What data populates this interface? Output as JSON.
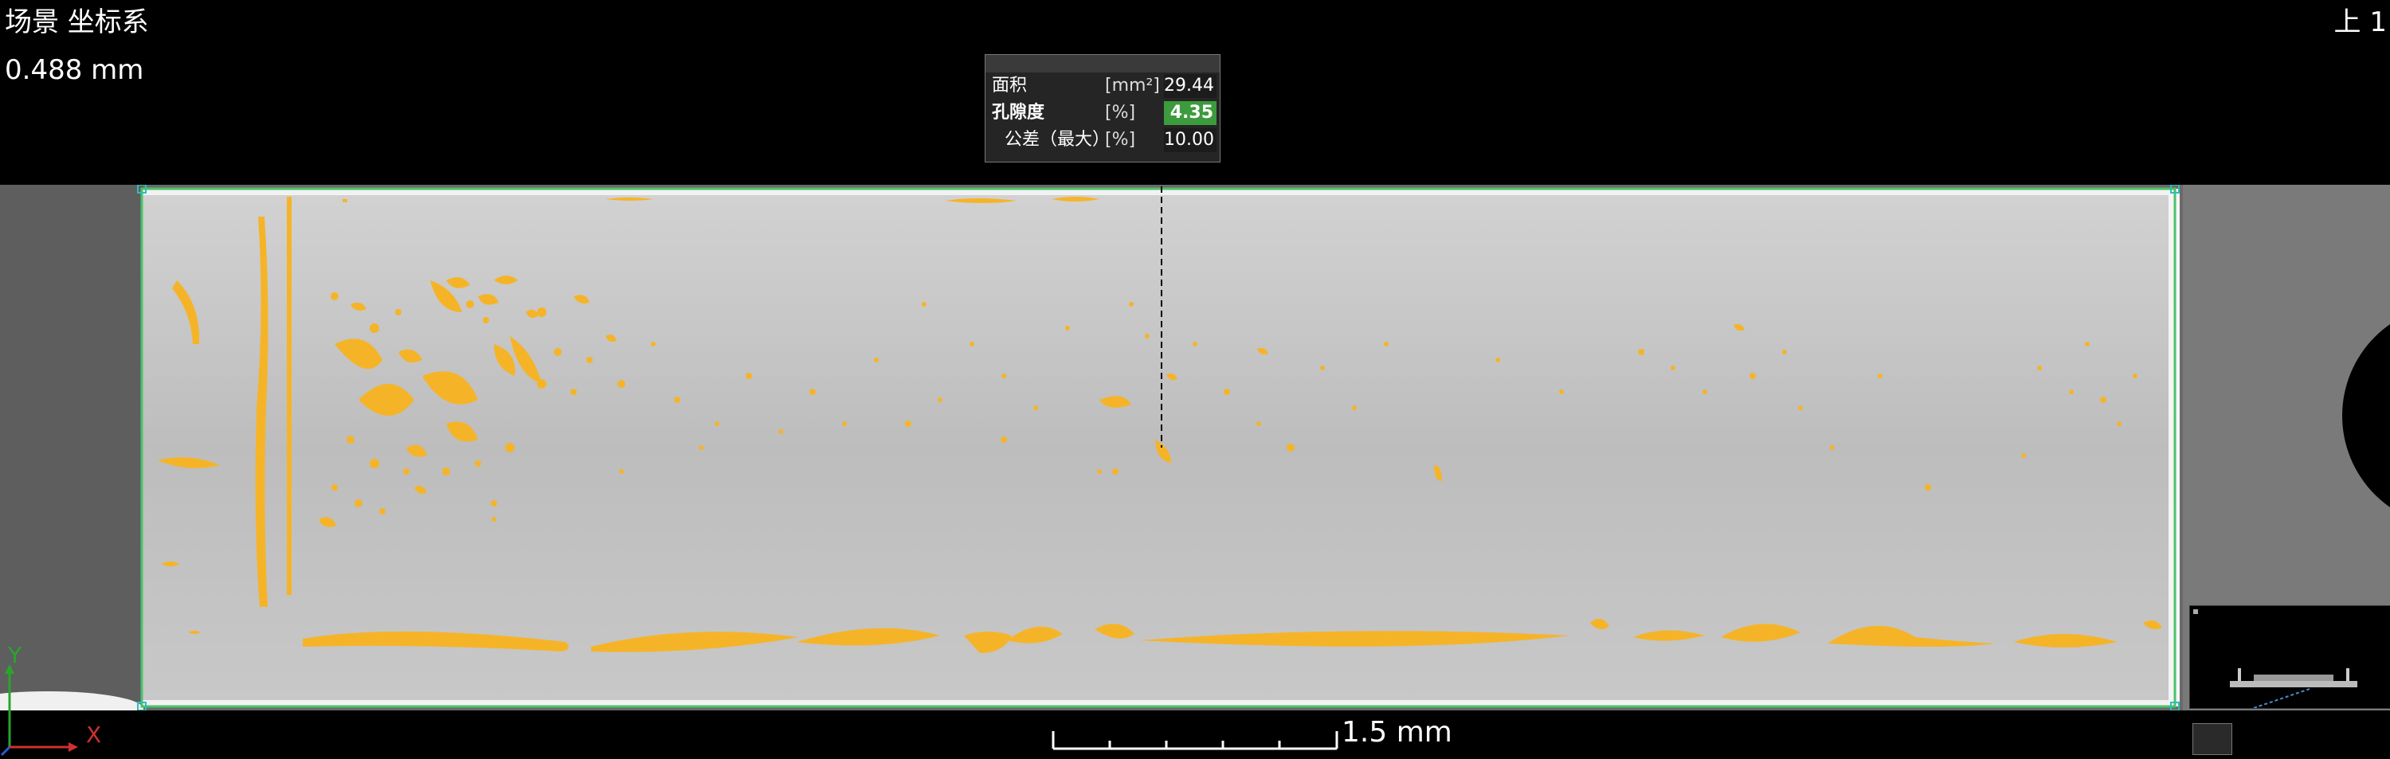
{
  "viewport": {
    "label": "场景 坐标系",
    "voxel_size": "0.488 mm",
    "view_direction": "上 1"
  },
  "annotation": {
    "rows": [
      {
        "name": "面积",
        "unit": "[mm²]",
        "value": "29.44"
      },
      {
        "name": "孔隙度",
        "unit": "[%]",
        "value": "4.35"
      },
      {
        "name": "公差（最大）",
        "unit": "[%]",
        "value": "10.00"
      }
    ]
  },
  "scale_bar": {
    "label": "1.5 mm"
  },
  "axes": {
    "x": "X",
    "y": "Y"
  },
  "colors": {
    "pores": "#f5b428",
    "roi_outline": "#49c46a",
    "porosity_ok": "#3c9b3c"
  }
}
